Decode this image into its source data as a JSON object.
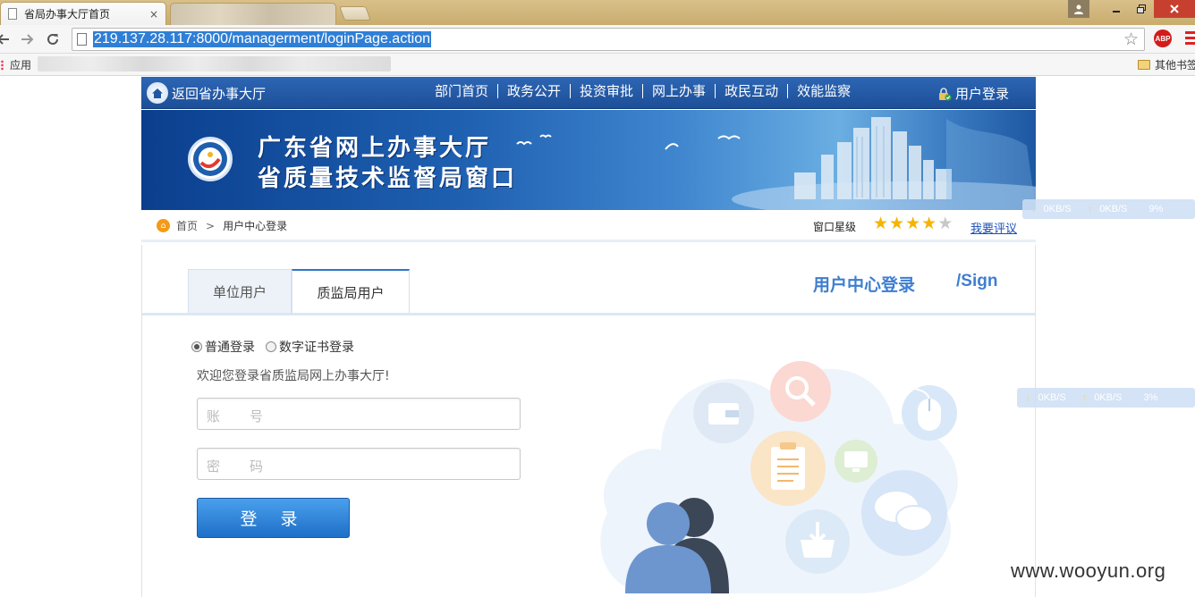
{
  "browser": {
    "tab_title": "省局办事大厅首页",
    "tab_close": "×",
    "url": "219.137.28.117:8000/managerment/loginPage.action",
    "abp_label": "ABP",
    "bookmarks_apps": "应用",
    "bookmarks_other": "其他书签"
  },
  "site": {
    "home_link": "返回省办事大厅",
    "nav": [
      "部门首页",
      "政务公开",
      "投资审批",
      "网上办事",
      "政民互动",
      "效能监察"
    ],
    "user_login": "用户登录",
    "banner_line1": "广东省网上办事大厅",
    "banner_line2": "省质量技术监督局窗口",
    "breadcrumb": {
      "home": "首页",
      "separator": ">",
      "current": "用户中心登录"
    },
    "rating": {
      "label": "窗口星级",
      "stars_filled": 4,
      "stars_total": 5,
      "link": "我要评议"
    }
  },
  "login": {
    "tabs": [
      "单位用户",
      "质监局用户"
    ],
    "active_tab": 1,
    "heading": "用户中心登录",
    "heading_en": "/Sign",
    "modes": [
      "普通登录",
      "数字证书登录"
    ],
    "selected_mode": 0,
    "welcome": "欢迎您登录省质监局网上办事大厅!",
    "account_placeholder": "账　　号",
    "password_placeholder": "密　　码",
    "submit": "登 录"
  },
  "overlays": {
    "speed1": {
      "down": "0KB/S",
      "up": "0KB/S",
      "pct": "9%"
    },
    "speed2": {
      "down": "0KB/S",
      "up": "0KB/S",
      "pct": "3%"
    },
    "watermark": "www.wooyun.org"
  },
  "colors": {
    "nav_bg": "#1d4f98",
    "accent": "#3f7ed0",
    "button": "#2878d0",
    "star_on": "#f5b400",
    "star_off": "#c8c8c8"
  }
}
